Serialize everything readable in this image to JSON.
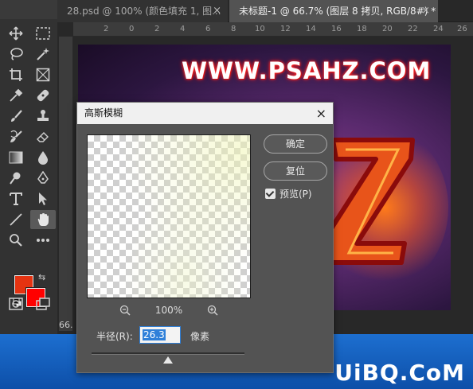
{
  "tabs": [
    {
      "label": "28.psd @ 100% (颜色填充 1, 图...",
      "close": "×"
    },
    {
      "label": "未标题-1 @ 66.7% (图层 8 拷贝, RGB/8#) *",
      "close": "×"
    }
  ],
  "ruler_marks": [
    "2",
    "0",
    "2",
    "4",
    "6",
    "8",
    "10",
    "12",
    "14",
    "16",
    "18",
    "20",
    "22",
    "24",
    "26"
  ],
  "status_zoom": "66.",
  "canvas": {
    "site_text": "WWW.PSAHZ.COM"
  },
  "colors": {
    "foreground": "#e53311",
    "background": "#ff0000",
    "accent": "#2f80d9"
  },
  "tools": [
    "move-tool-icon",
    "marquee-tool-icon",
    "lasso-tool-icon",
    "magic-wand-icon",
    "crop-tool-icon",
    "frame-tool-icon",
    "eyedropper-icon",
    "healing-brush-icon",
    "brush-icon",
    "stamp-icon",
    "history-brush-icon",
    "eraser-icon",
    "gradient-icon",
    "blur-icon",
    "dodge-icon",
    "pen-icon",
    "type-icon",
    "path-select-icon",
    "line-icon",
    "hand-icon",
    "zoom-icon",
    "more-icon",
    "quick-mask-icon",
    "screen-mode-icon"
  ],
  "dialog": {
    "title": "高斯模糊",
    "close": "×",
    "ok_label": "确定",
    "reset_label": "复位",
    "preview_label": "预览(P)",
    "preview_checked": true,
    "zoom_out": "−",
    "zoom_level": "100%",
    "zoom_in": "+",
    "radius_label": "半径(R):",
    "radius_value": "26.3",
    "radius_unit": "像素",
    "slider_level": 0.5
  },
  "watermark": "UiBQ.CoM"
}
